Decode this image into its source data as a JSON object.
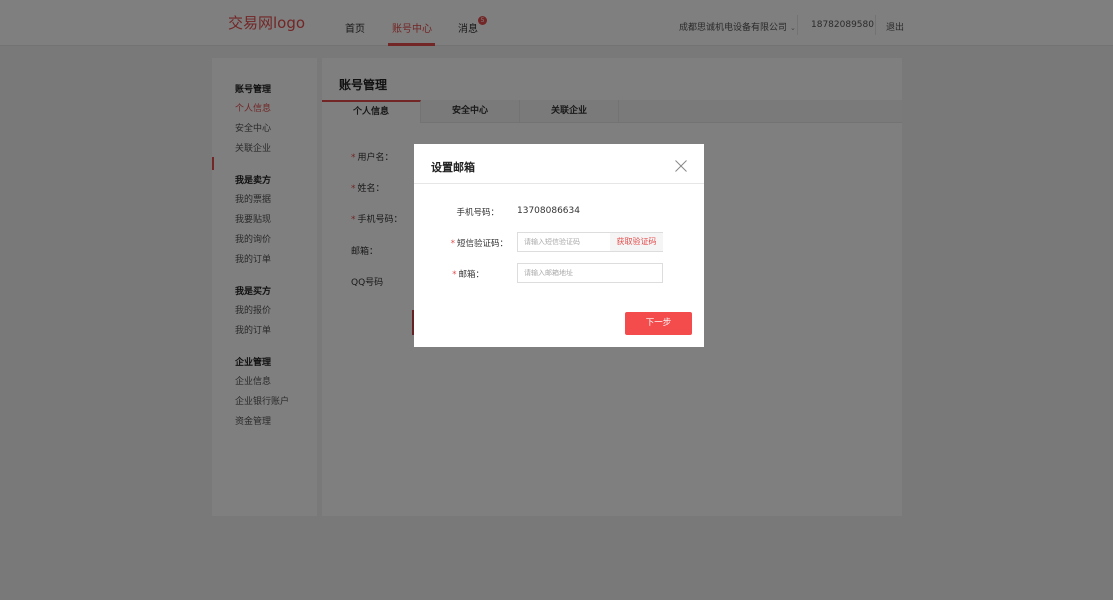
{
  "header": {
    "logo": "交易网logo",
    "nav": [
      {
        "label": "首页"
      },
      {
        "label": "账号中心"
      },
      {
        "label": "消息"
      }
    ],
    "message_badge": "5",
    "company": "成都思诚机电设备有限公司",
    "phone": "18782089580",
    "logout": "退出"
  },
  "sidebar": {
    "sections": [
      {
        "title": "账号管理",
        "items": [
          "个人信息",
          "安全中心",
          "关联企业"
        ]
      },
      {
        "title": "我是卖方",
        "items": [
          "我的票据",
          "我要贴现",
          "我的询价",
          "我的订单"
        ]
      },
      {
        "title": "我是买方",
        "items": [
          "我的报价",
          "我的订单"
        ]
      },
      {
        "title": "企业管理",
        "items": [
          "企业信息",
          "企业银行账户",
          "资金管理"
        ]
      }
    ]
  },
  "main": {
    "title": "账号管理",
    "tabs": [
      "个人信息",
      "安全中心",
      "关联企业"
    ],
    "form_labels": [
      "用户名：",
      "姓名：",
      "手机号码：",
      "邮箱：",
      "QQ号码"
    ]
  },
  "modal": {
    "title": "设置邮箱",
    "phone_label": "手机号码：",
    "phone_value": "13708086634",
    "sms_label": "短信验证码：",
    "sms_placeholder": "请输入短信验证码",
    "get_code_label": "获取验证码",
    "email_label": "邮箱：",
    "email_placeholder": "请输入邮箱地址",
    "next_label": "下一步"
  },
  "colors": {
    "accent": "#e44c4c",
    "button": "#f44c4c"
  }
}
